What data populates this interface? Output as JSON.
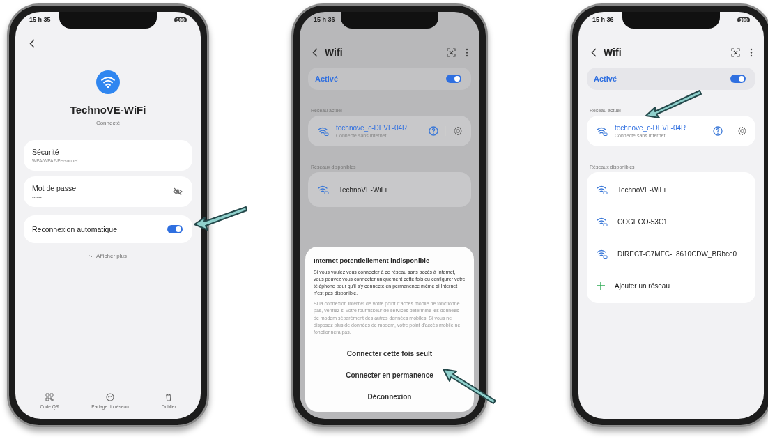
{
  "phones": [
    {
      "kind": "details",
      "dimmed": false,
      "status": {
        "time": "15 h 35",
        "battery": "100"
      },
      "network_name": "TechnoVE-WiFi",
      "connection": "Connecté",
      "settings": [
        {
          "kind": "info",
          "label": "Sécurité",
          "value": "WPA/WPA2-Personnel"
        },
        {
          "kind": "password",
          "label": "Mot de passe",
          "value": "••••••"
        },
        {
          "kind": "toggle",
          "label": "Reconnexion automatique",
          "on": true
        }
      ],
      "show_more": "Afficher plus",
      "actions": [
        {
          "label": "Code QR"
        },
        {
          "label": "Partage du réseau"
        },
        {
          "label": "Oublier"
        }
      ]
    },
    {
      "kind": "list",
      "dimmed": true,
      "status": {
        "time": "15 h 36"
      },
      "title": "Wifi",
      "master": {
        "label": "Activé",
        "on": true
      },
      "current_label": "Réseau actuel",
      "current": {
        "name": "technove_c-DEVL-04R",
        "status": "Connecté sans Internet"
      },
      "available_label": "Réseaux disponibles",
      "networks": [
        "TechnoVE-WiFi"
      ],
      "dialog": {
        "title": "Internet potentiellement indisponible",
        "body": "Si vous voulez vous connecter à ce réseau sans accès à Internet, vous pouvez vous connecter uniquement cette fois ou configurer votre téléphone pour qu'il s'y connecte en permanence même si Internet n'est pas disponible.",
        "note": "Si la connexion Internet de votre point d'accès mobile ne fonctionne pas, vérifiez si votre fournisseur de services détermine les données de modem séparément des autres données mobiles. Si vous ne disposez plus de données de modem, votre point d'accès mobile ne fonctionnera pas.",
        "buttons": [
          "Connecter cette fois seult",
          "Connecter en permanence",
          "Déconnexion"
        ]
      }
    },
    {
      "kind": "list",
      "dimmed": false,
      "status": {
        "time": "15 h 36",
        "battery": "100"
      },
      "title": "Wifi",
      "master": {
        "label": "Activé",
        "on": true
      },
      "current_label": "Réseau actuel",
      "current": {
        "name": "technove_c-DEVL-04R",
        "status": "Connecté sans Internet"
      },
      "available_label": "Réseaux disponibles",
      "networks": [
        "TechnoVE-WiFi",
        "COGECO-53C1",
        "DIRECT-G7MFC-L8610CDW_BRbce0"
      ],
      "add_label": "Ajouter un réseau"
    }
  ]
}
